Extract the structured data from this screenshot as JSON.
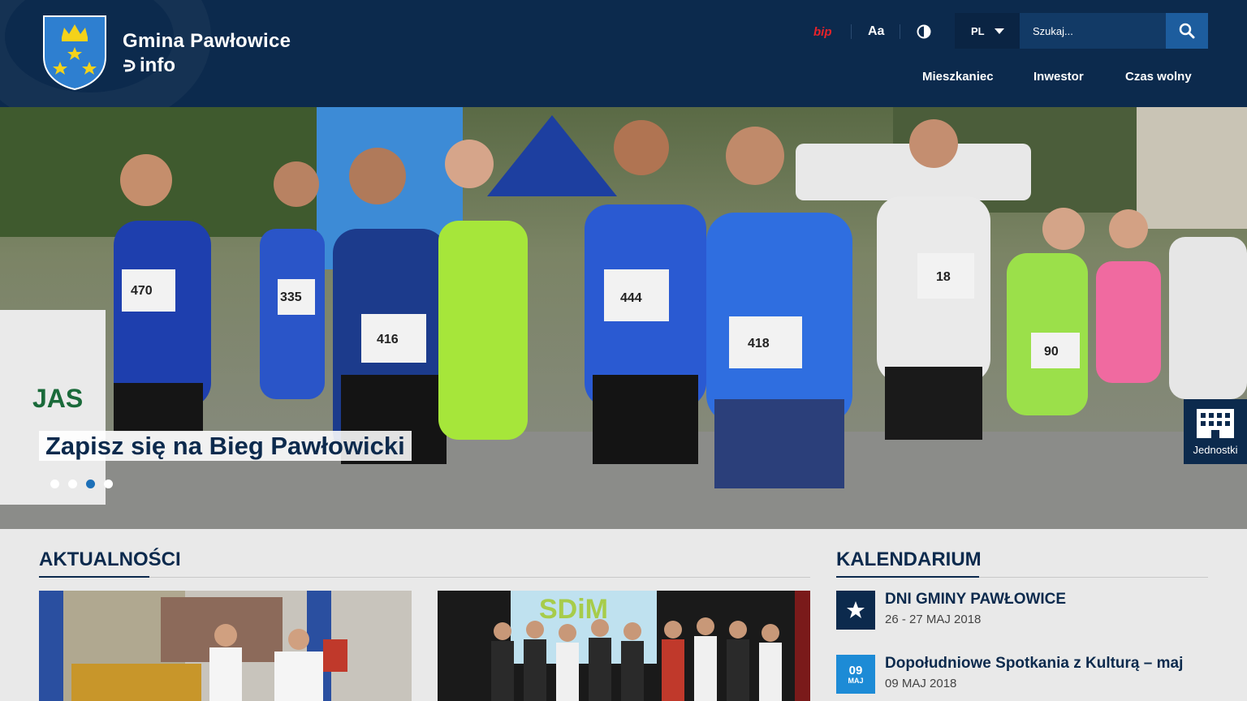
{
  "header": {
    "brand_title": "Gmina Pawłowice",
    "brand_sub": "info",
    "bip": "bip",
    "font_size_toggle": "Aa",
    "language": "PL",
    "search": {
      "placeholder": "Szukaj..."
    },
    "nav": [
      {
        "label": "Mieszkaniec"
      },
      {
        "label": "Inwestor"
      },
      {
        "label": "Czas wolny"
      }
    ]
  },
  "hero": {
    "caption": "Zapisz się na Bieg Pawłowicki",
    "slides": 4,
    "active_slide": 3,
    "jednostki_label": "Jednostki",
    "bibs": [
      "470",
      "335",
      "416",
      "444",
      "418",
      "18",
      "90"
    ]
  },
  "news": {
    "title": "AKTUALNOŚCI",
    "card2_logo": "SDiM"
  },
  "calendar": {
    "title": "KALENDARIUM",
    "events": [
      {
        "title": "DNI GMINY PAWŁOWICE",
        "date": "26 - 27 MAJ 2018",
        "icon": "star-icon"
      },
      {
        "title": "Dopołudniowe Spotkania z Kulturą – maj",
        "date": "09 MAJ 2018",
        "day": "09",
        "month": "MAJ"
      }
    ]
  },
  "colors": {
    "navy": "#0c2a4d",
    "blue": "#1d8bd6",
    "accent": "#1d5d9e",
    "bip_red": "#e8232a"
  }
}
